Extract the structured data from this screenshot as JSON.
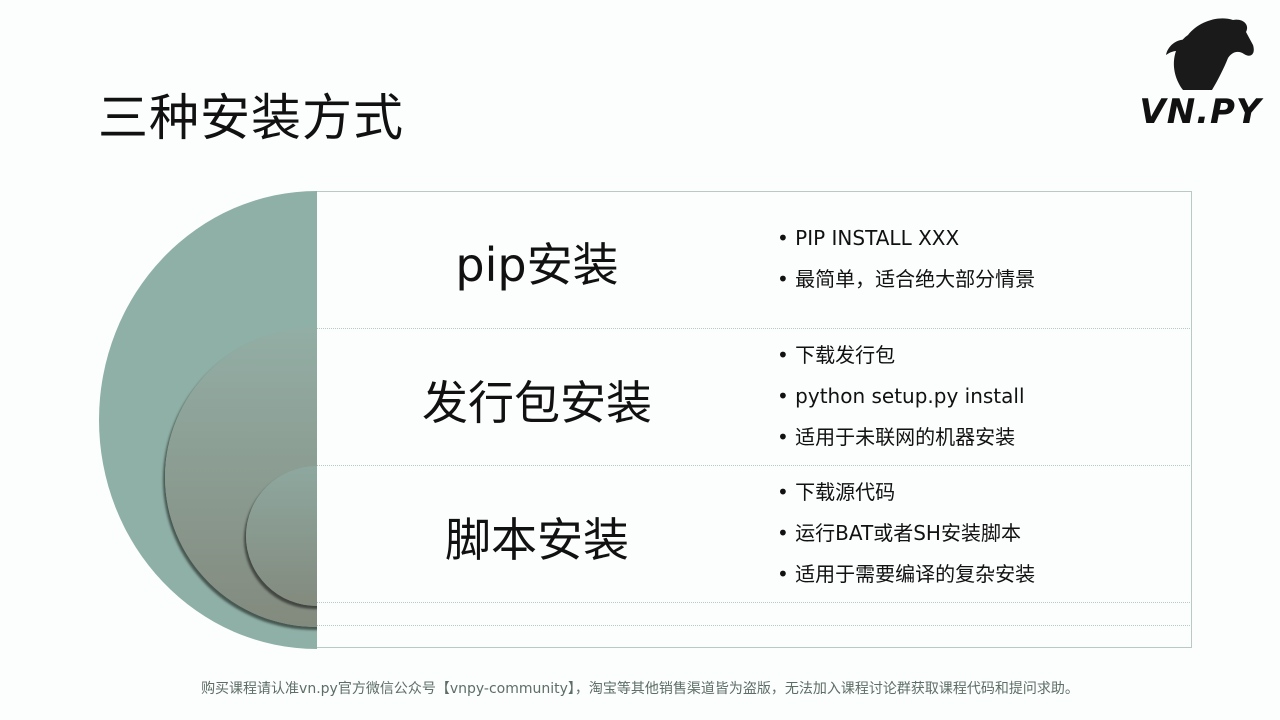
{
  "title": "三种安装方式",
  "logo": {
    "text": "VN.PY",
    "icon": "horse-head-icon"
  },
  "rows": [
    {
      "title": "pip安装",
      "bullets": [
        "PIP INSTALL XXX",
        "最简单，适合绝大部分情景"
      ]
    },
    {
      "title": "发行包安装",
      "bullets": [
        "下载发行包",
        "python setup.py install",
        "适用于未联网的机器安装"
      ]
    },
    {
      "title": "脚本安装",
      "bullets": [
        "下载源代码",
        "运行BAT或者SH安装脚本",
        "适用于需要编译的复杂安装"
      ]
    }
  ],
  "footer": "购买课程请认准vn.py官方微信公众号【vnpy-community】，淘宝等其他销售渠道皆为盗版，无法加入课程讨论群获取课程代码和提问求助。"
}
